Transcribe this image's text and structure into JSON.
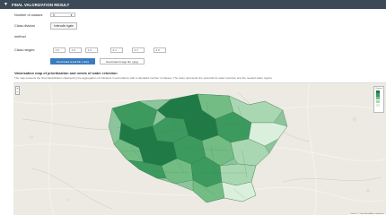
{
  "header": {
    "title": "FINAL VALORIZATION RESULT"
  },
  "controls": {
    "num_classes_label": "Number of classes",
    "num_classes_value": "5",
    "class_division_label": "Class division",
    "class_division_button": "Intervalle égale",
    "method_label": "method",
    "class_ranges_label": "Class ranges:",
    "class_ranges": [
      "1.5",
      "1.6",
      "1.9",
      "2.1",
      "2.1",
      "2.5"
    ],
    "download_button": "Download result file (.shp)",
    "download_image_button": "Download image file (.jpg)"
  },
  "map": {
    "title": "Valorisation map of prioritization and needs of water retention",
    "subtitle": "The map presents the final classification obtained by the aggregation of indicators in accordance with a stipulated number of classes. The class represents the potential for water retention and the needed water regime.",
    "zoom_in": "+",
    "zoom_out": "−",
    "legend_title": "Classes",
    "legend_colors": [
      "#1f7a46",
      "#3c9a5f",
      "#73bd85",
      "#a9d7b1",
      "#dbefdd"
    ],
    "attribution": "Leaflet | © OpenStreetMap contributors"
  }
}
